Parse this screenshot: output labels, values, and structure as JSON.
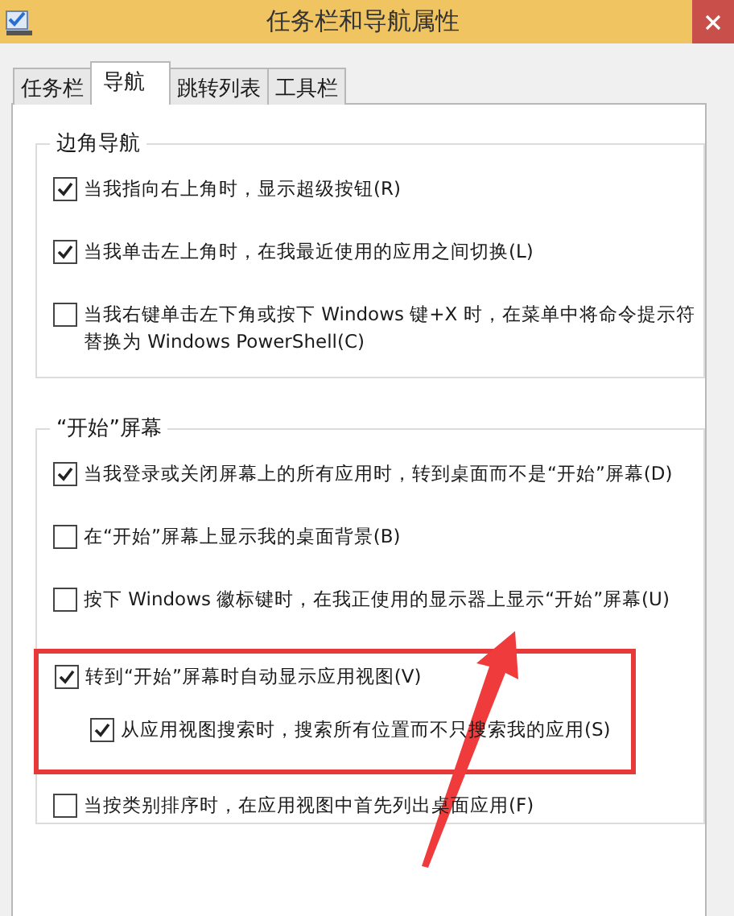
{
  "window": {
    "title": "任务栏和导航属性"
  },
  "tabs": [
    {
      "label": "任务栏",
      "selected": false
    },
    {
      "label": "导航",
      "selected": true
    },
    {
      "label": "跳转列表",
      "selected": false
    },
    {
      "label": "工具栏",
      "selected": false
    }
  ],
  "groups": [
    {
      "title": "边角导航",
      "items": [
        {
          "label": "当我指向右上角时，显示超级按钮(R)",
          "checked": true,
          "highlighted": false
        },
        {
          "label": "当我单击左上角时，在我最近使用的应用之间切换(L)",
          "checked": true,
          "highlighted": false
        },
        {
          "label": "当我右键单击左下角或按下 Windows 键+X 时，在菜单中将命令提示符替换为 Windows PowerShell(C)",
          "checked": false,
          "highlighted": false
        }
      ]
    },
    {
      "title": "“开始”屏幕",
      "items": [
        {
          "label": "当我登录或关闭屏幕上的所有应用时，转到桌面而不是“开始”屏幕(D)",
          "checked": true,
          "highlighted": false
        },
        {
          "label": "在“开始”屏幕上显示我的桌面背景(B)",
          "checked": false,
          "highlighted": false
        },
        {
          "label": "按下 Windows 徽标键时，在我正使用的显示器上显示“开始”屏幕(U)",
          "checked": false,
          "highlighted": false
        },
        {
          "label": "转到“开始”屏幕时自动显示应用视图(V)",
          "checked": true,
          "highlighted": true,
          "children": [
            {
              "label": "从应用视图搜索时，搜索所有位置而不只搜索我的应用(S)",
              "checked": true
            }
          ]
        },
        {
          "label": "当按类别排序时，在应用视图中首先列出桌面应用(F)",
          "checked": false,
          "highlighted": false
        }
      ]
    }
  ]
}
